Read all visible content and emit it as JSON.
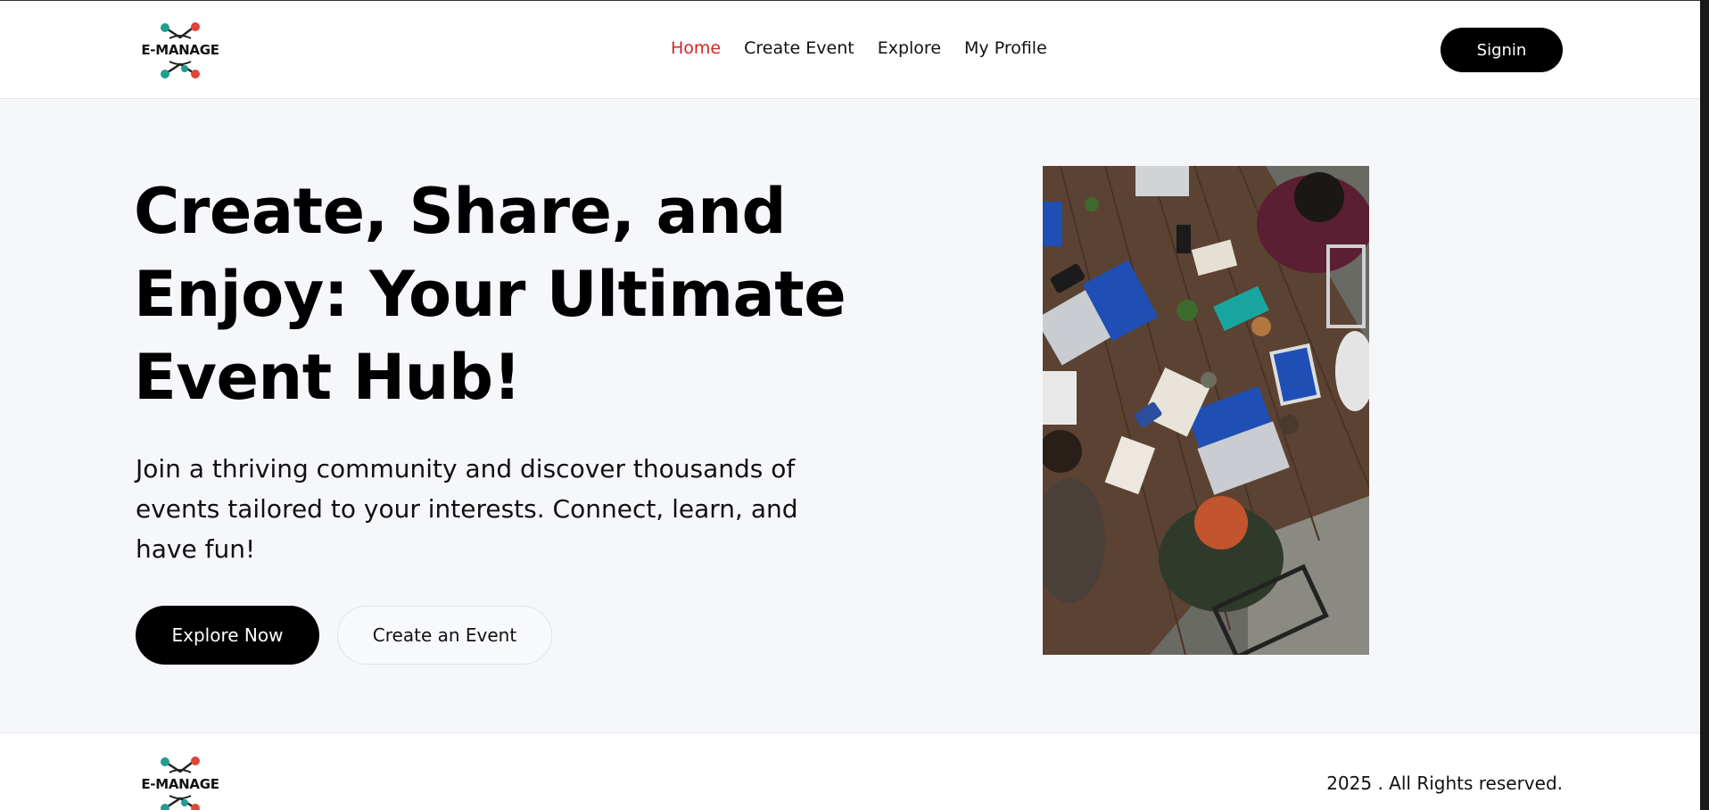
{
  "header": {
    "logo_text": "E-MANAGE",
    "nav": [
      {
        "label": "Home",
        "active": true
      },
      {
        "label": "Create Event",
        "active": false
      },
      {
        "label": "Explore",
        "active": false
      },
      {
        "label": "My Profile",
        "active": false
      }
    ],
    "signin_label": "Signin"
  },
  "hero": {
    "headline_lines": [
      "Create, Share, and",
      "Enjoy: Your Ultimate",
      "Event Hub!"
    ],
    "subtext": "Join a thriving community and discover thousands of events tailored to your interests. Connect, learn, and have fun!",
    "primary_button": "Explore Now",
    "secondary_button": "Create an Event",
    "image_subject": "people-working-at-table-with-laptops"
  },
  "footer": {
    "logo_text": "E-MANAGE",
    "copyright": "2025 . All Rights reserved."
  },
  "colors": {
    "accent_active_nav": "#d42525",
    "hero_background": "#f6f7fb",
    "logo_teal": "#1f9e8f",
    "logo_red": "#e0463a"
  }
}
